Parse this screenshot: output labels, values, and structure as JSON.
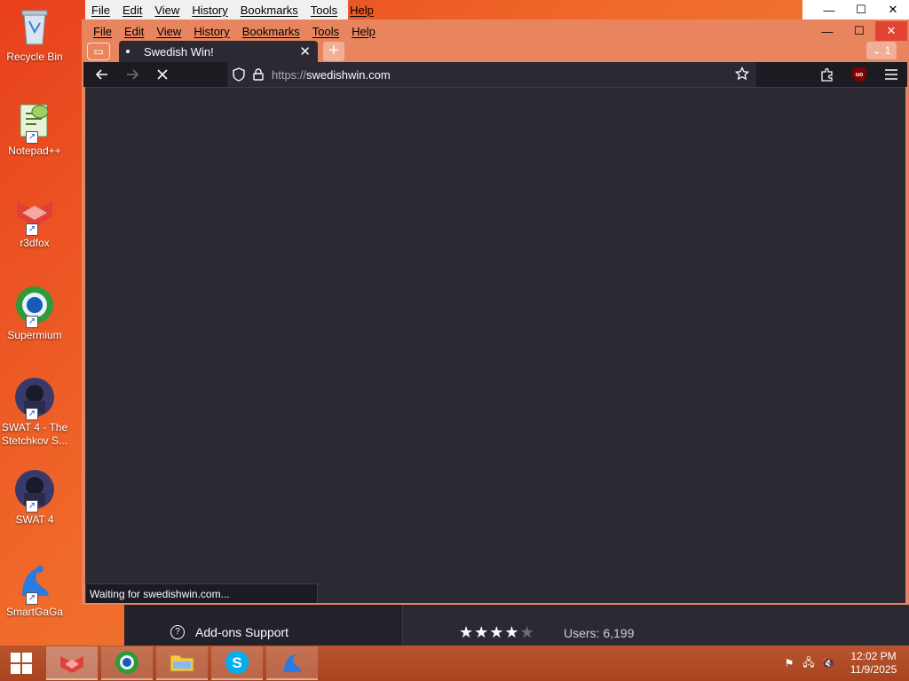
{
  "desktop": {
    "icons": [
      {
        "label": "Recycle Bin"
      },
      {
        "label": "Notepad++"
      },
      {
        "label": "r3dfox"
      },
      {
        "label": "Supermium"
      },
      {
        "label": "SWAT 4 - The Stetchkov S..."
      },
      {
        "label": "SWAT 4"
      },
      {
        "label": "SmartGaGa"
      }
    ]
  },
  "back_window": {
    "menu": [
      "File",
      "Edit",
      "View",
      "History",
      "Bookmarks",
      "Tools",
      "Help"
    ],
    "addons_support": "Add-ons Support",
    "users_text": "Users: 6,199",
    "rating_stars": 4
  },
  "browser": {
    "menu": [
      "File",
      "Edit",
      "View",
      "History",
      "Bookmarks",
      "Tools",
      "Help"
    ],
    "tab": {
      "title": "Swedish Win!"
    },
    "tab_count": "1",
    "url": {
      "protocol": "https://",
      "host": "swedishwin.com"
    },
    "status": "Waiting for swedishwin.com..."
  },
  "taskbar": {
    "time": "12:02 PM",
    "date": "11/9/2025"
  },
  "colors": {
    "desktop_orange": "#f06a2a",
    "browser_dark": "#2b2a33",
    "frame_orange": "#e8845e"
  }
}
